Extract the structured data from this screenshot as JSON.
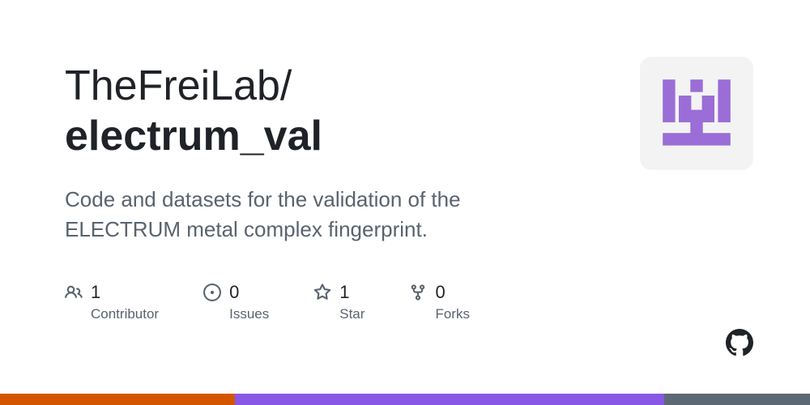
{
  "repo": {
    "owner": "TheFreiLab",
    "separator": "/",
    "name": "electrum_val",
    "description": "Code and datasets for the validation of the ELECTRUM metal complex fingerprint."
  },
  "stats": {
    "contributors": {
      "count": "1",
      "label": "Contributor"
    },
    "issues": {
      "count": "0",
      "label": "Issues"
    },
    "stars": {
      "count": "1",
      "label": "Star"
    },
    "forks": {
      "count": "0",
      "label": "Forks"
    }
  },
  "stripe": {
    "orange": "#d45500",
    "purple": "#8957e5",
    "gray": "#5c6975"
  }
}
